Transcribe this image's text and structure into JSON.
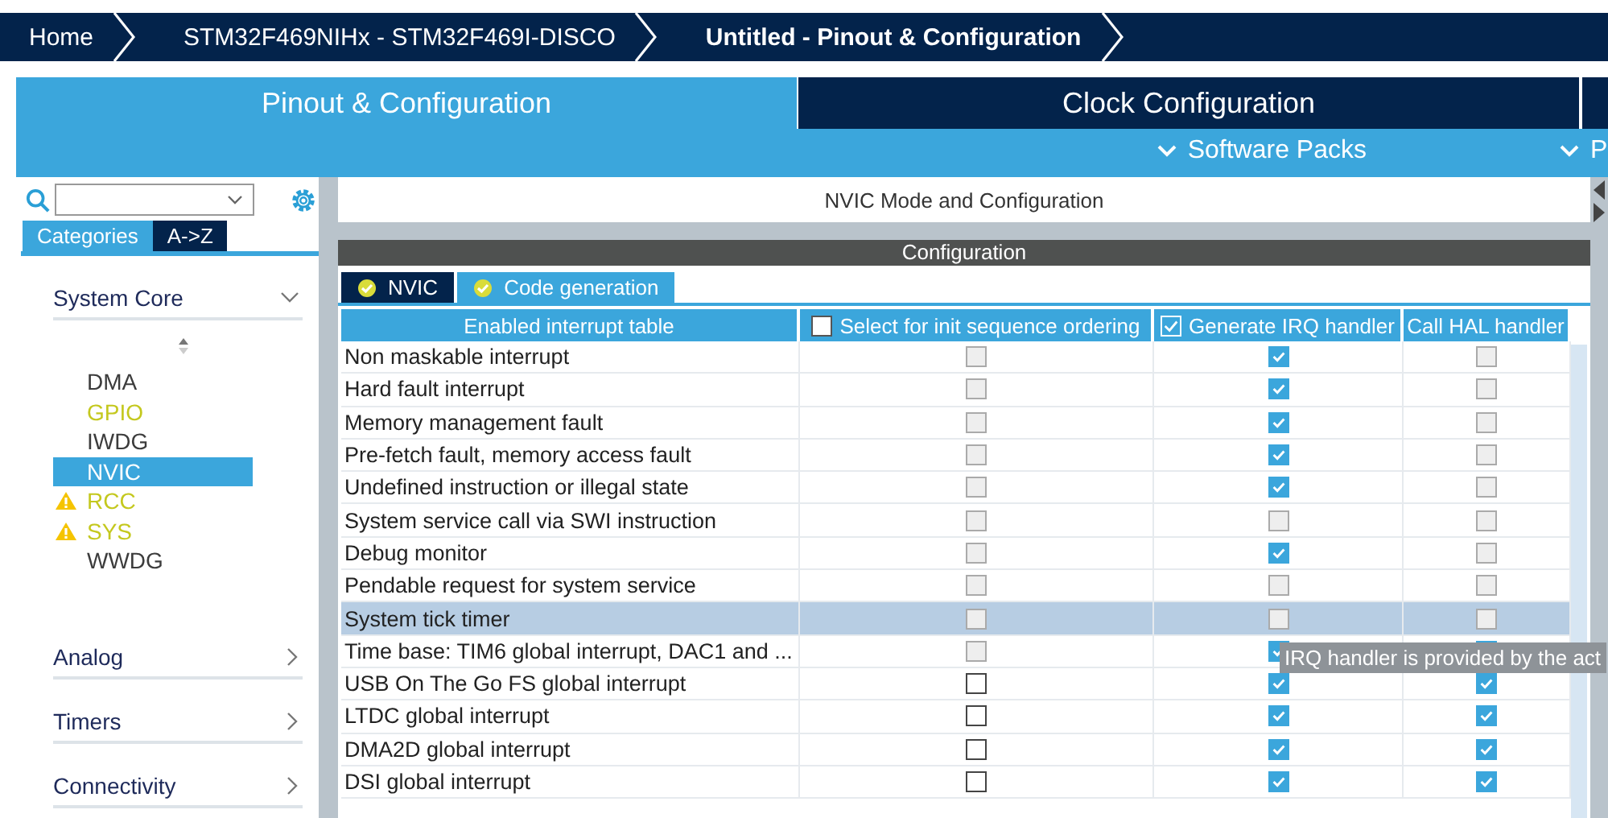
{
  "breadcrumb": [
    {
      "label": "Home",
      "current": false
    },
    {
      "label": "STM32F469NIHx  -  STM32F469I-DISCO",
      "current": false
    },
    {
      "label": "Untitled - Pinout & Configuration",
      "current": true
    }
  ],
  "main_tabs": [
    {
      "label": "Pinout & Configuration",
      "selected": true
    },
    {
      "label": "Clock Configuration",
      "selected": false
    }
  ],
  "sub_menu": [
    {
      "label": "Software Packs"
    },
    {
      "label": "P"
    }
  ],
  "sidebar": {
    "view_tabs": [
      {
        "label": "Categories",
        "selected": true
      },
      {
        "label": "A->Z",
        "selected": false
      }
    ],
    "categories": [
      {
        "label": "System Core",
        "expanded": true,
        "children": [
          {
            "label": "DMA",
            "color": "#3c3c3c",
            "warning": false,
            "selected": false
          },
          {
            "label": "GPIO",
            "color": "#c4c81e",
            "warning": false,
            "selected": false
          },
          {
            "label": "IWDG",
            "color": "#3c3c3c",
            "warning": false,
            "selected": false
          },
          {
            "label": "NVIC",
            "color": "#ffffff",
            "warning": false,
            "selected": true
          },
          {
            "label": "RCC",
            "color": "#c4c81e",
            "warning": true,
            "selected": false
          },
          {
            "label": "SYS",
            "color": "#c4c81e",
            "warning": true,
            "selected": false
          },
          {
            "label": "WWDG",
            "color": "#3c3c3c",
            "warning": false,
            "selected": false
          }
        ]
      },
      {
        "label": "Analog",
        "expanded": false
      },
      {
        "label": "Timers",
        "expanded": false
      },
      {
        "label": "Connectivity",
        "expanded": false
      }
    ]
  },
  "panel_title": "NVIC Mode and Configuration",
  "config_title": "Configuration",
  "config_tabs": [
    {
      "label": "NVIC",
      "selected": false
    },
    {
      "label": "Code generation",
      "selected": true
    }
  ],
  "table": {
    "columns": [
      {
        "label": "Enabled interrupt table",
        "kind": "plain"
      },
      {
        "label": "Select for init sequence ordering",
        "kind": "checkbox",
        "checked": false
      },
      {
        "label": "Generate IRQ handler",
        "kind": "checkbox",
        "checked": true
      },
      {
        "label": "Call HAL handler",
        "kind": "plain"
      }
    ],
    "rows": [
      {
        "label": "Non maskable interrupt",
        "selected": false,
        "init": {
          "checked": false,
          "disabled": true
        },
        "irq": {
          "checked": true,
          "disabled": false
        },
        "hal": {
          "checked": false,
          "disabled": true
        }
      },
      {
        "label": "Hard fault interrupt",
        "selected": false,
        "init": {
          "checked": false,
          "disabled": true
        },
        "irq": {
          "checked": true,
          "disabled": false
        },
        "hal": {
          "checked": false,
          "disabled": true
        }
      },
      {
        "label": "Memory management fault",
        "selected": false,
        "init": {
          "checked": false,
          "disabled": true
        },
        "irq": {
          "checked": true,
          "disabled": false
        },
        "hal": {
          "checked": false,
          "disabled": true
        }
      },
      {
        "label": "Pre-fetch fault, memory access fault",
        "selected": false,
        "init": {
          "checked": false,
          "disabled": true
        },
        "irq": {
          "checked": true,
          "disabled": false
        },
        "hal": {
          "checked": false,
          "disabled": true
        }
      },
      {
        "label": "Undefined instruction or illegal state",
        "selected": false,
        "init": {
          "checked": false,
          "disabled": true
        },
        "irq": {
          "checked": true,
          "disabled": false
        },
        "hal": {
          "checked": false,
          "disabled": true
        }
      },
      {
        "label": "System service call via SWI instruction",
        "selected": false,
        "init": {
          "checked": false,
          "disabled": true
        },
        "irq": {
          "checked": false,
          "disabled": true
        },
        "hal": {
          "checked": false,
          "disabled": true
        }
      },
      {
        "label": "Debug monitor",
        "selected": false,
        "init": {
          "checked": false,
          "disabled": true
        },
        "irq": {
          "checked": true,
          "disabled": false
        },
        "hal": {
          "checked": false,
          "disabled": true
        }
      },
      {
        "label": "Pendable request for system service",
        "selected": false,
        "init": {
          "checked": false,
          "disabled": true
        },
        "irq": {
          "checked": false,
          "disabled": true
        },
        "hal": {
          "checked": false,
          "disabled": true
        }
      },
      {
        "label": "System tick timer",
        "selected": true,
        "init": {
          "checked": false,
          "disabled": true
        },
        "irq": {
          "checked": false,
          "disabled": true
        },
        "hal": {
          "checked": false,
          "disabled": true
        }
      },
      {
        "label": "Time base: TIM6 global interrupt, DAC1 and ...",
        "selected": false,
        "init": {
          "checked": false,
          "disabled": true
        },
        "irq": {
          "checked": true,
          "disabled": false
        },
        "hal": {
          "checked": true,
          "disabled": false
        }
      },
      {
        "label": "USB On The Go FS global interrupt",
        "selected": false,
        "init": {
          "checked": false,
          "disabled": false
        },
        "irq": {
          "checked": true,
          "disabled": false
        },
        "hal": {
          "checked": true,
          "disabled": false
        }
      },
      {
        "label": "LTDC global interrupt",
        "selected": false,
        "init": {
          "checked": false,
          "disabled": false
        },
        "irq": {
          "checked": true,
          "disabled": false
        },
        "hal": {
          "checked": true,
          "disabled": false
        }
      },
      {
        "label": "DMA2D global interrupt",
        "selected": false,
        "init": {
          "checked": false,
          "disabled": false
        },
        "irq": {
          "checked": true,
          "disabled": false
        },
        "hal": {
          "checked": true,
          "disabled": false
        }
      },
      {
        "label": "DSI global interrupt",
        "selected": false,
        "init": {
          "checked": false,
          "disabled": false
        },
        "irq": {
          "checked": true,
          "disabled": false
        },
        "hal": {
          "checked": true,
          "disabled": false
        }
      }
    ]
  },
  "tooltip": "IRQ handler is provided by the act"
}
